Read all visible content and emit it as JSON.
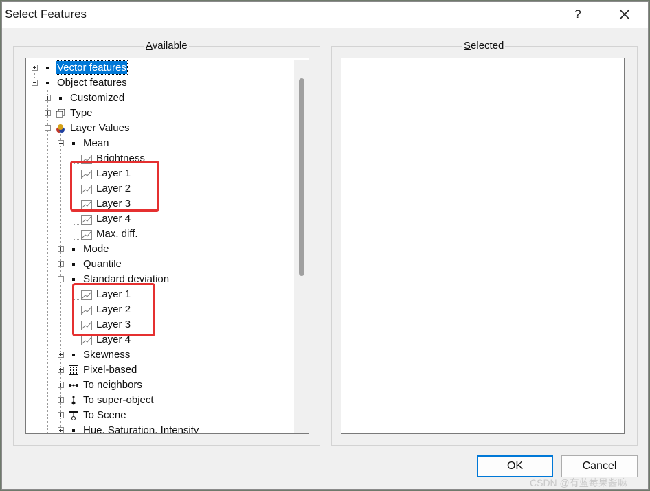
{
  "window": {
    "title": "Select Features",
    "help_label": "?"
  },
  "available": {
    "label": "Available",
    "label_accel": "A",
    "label_rest": "vailable",
    "tree": [
      {
        "label": "Vector features",
        "selected": true
      },
      {
        "label": "Object features"
      },
      {
        "label": "Customized"
      },
      {
        "label": "Type"
      },
      {
        "label": "Layer Values"
      },
      {
        "label": "Mean"
      },
      {
        "label": "Brightness"
      },
      {
        "label": "Layer 1"
      },
      {
        "label": "Layer 2"
      },
      {
        "label": "Layer 3"
      },
      {
        "label": "Layer 4"
      },
      {
        "label": "Max. diff."
      },
      {
        "label": "Mode"
      },
      {
        "label": "Quantile"
      },
      {
        "label": "Standard deviation"
      },
      {
        "label": "Layer 1"
      },
      {
        "label": "Layer 2"
      },
      {
        "label": "Layer 3"
      },
      {
        "label": "Layer 4"
      },
      {
        "label": "Skewness"
      },
      {
        "label": "Pixel-based"
      },
      {
        "label": "To neighbors"
      },
      {
        "label": "To super-object"
      },
      {
        "label": "To Scene"
      },
      {
        "label": "Hue, Saturation, Intensity"
      }
    ]
  },
  "selected_panel": {
    "label": "Selected",
    "label_accel": "S",
    "label_rest": "elected"
  },
  "buttons": {
    "ok": {
      "label": "OK",
      "accel": "O",
      "rest": "K"
    },
    "cancel": {
      "label": "Cancel",
      "accel": "C",
      "rest": "ancel"
    }
  },
  "annotations": {
    "highlight_color": "#e53030"
  },
  "watermark": "CSDN @有蓝莓果酱嘛"
}
